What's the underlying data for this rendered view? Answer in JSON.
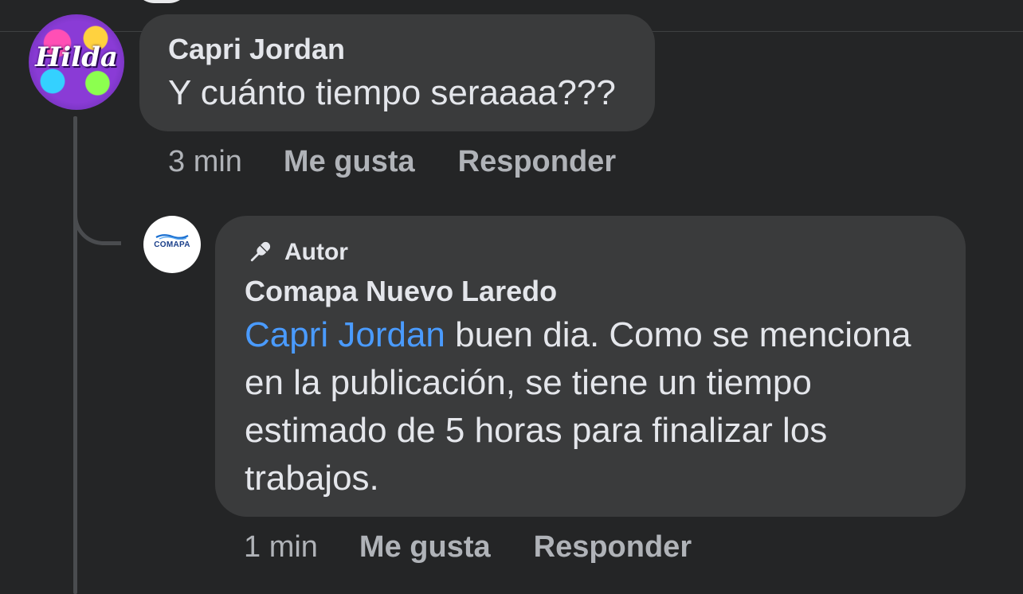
{
  "comments": [
    {
      "author": "Capri Jordan",
      "avatar_text": "Hilda",
      "text": "Y cuánto tiempo seraaaa???",
      "time": "3 min",
      "like_label": "Me gusta",
      "reply_label": "Responder"
    },
    {
      "badge": "Autor",
      "badge_icon": "microphone-icon",
      "author": "Comapa Nuevo Laredo",
      "avatar_text": "COMAPA",
      "mention": "Capri Jordan",
      "text": " buen dia. Como se menciona en la publicación, se tiene un tiempo estimado de 5 horas para finalizar los trabajos.",
      "time": "1 min",
      "like_label": "Me gusta",
      "reply_label": "Responder"
    }
  ],
  "colors": {
    "background": "#242526",
    "bubble": "#3a3b3c",
    "text_primary": "#e4e6eb",
    "text_secondary": "#b0b3b8",
    "mention": "#4a9bff",
    "thread_line": "#4a4c4f"
  }
}
